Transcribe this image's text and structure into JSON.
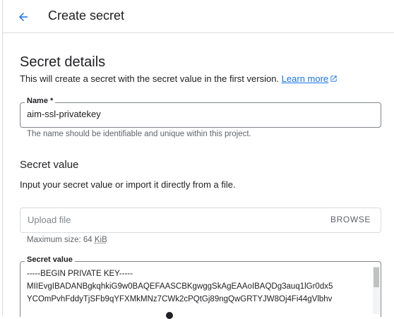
{
  "header": {
    "title": "Create secret",
    "back_icon": "arrow-back-icon"
  },
  "colors": {
    "accent": "#1a73e8",
    "border": "#80868b",
    "hint": "#5f6368"
  },
  "details": {
    "title": "Secret details",
    "intro": "This will create a secret with the secret value in the first version.",
    "learn_more": "Learn more",
    "external_icon": "open-in-new-icon"
  },
  "name_field": {
    "label": "Name *",
    "value": "aim-ssl-privatekey",
    "hint": "The name should be identifiable and unique within this project."
  },
  "secret_value": {
    "title": "Secret value",
    "description": "Input your secret value or import it directly from a file.",
    "upload_placeholder": "Upload file",
    "browse_label": "BROWSE",
    "max_size_prefix": "Maximum size: 64 ",
    "max_size_unit": "KiB",
    "field_label": "Secret value",
    "value": "-----BEGIN PRIVATE KEY-----\nMIIEvgIBADANBgkqhkiG9w0BAQEFAASCBKgwggSkAgEAAoIBAQDg3auq1lGr0dx5\nYCOmPvhFddyTjSFb9qYFXMkMNz7CWk2cPQtGj89ngQwGRTYJW8Oj4Fi44gVlbhv"
  }
}
